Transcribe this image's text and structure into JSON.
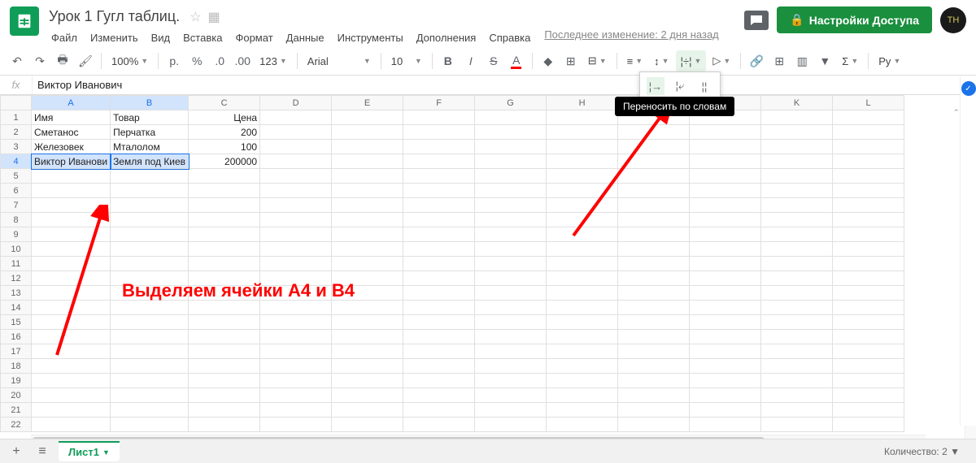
{
  "doc_title": "Урок 1 Гугл таблиц.",
  "menubar": [
    "Файл",
    "Изменить",
    "Вид",
    "Вставка",
    "Формат",
    "Данные",
    "Инструменты",
    "Дополнения",
    "Справка"
  ],
  "last_edit": "Последнее изменение: 2 дня назад",
  "share_label": "Настройки Доступа",
  "toolbar": {
    "zoom": "100%",
    "currency": "р.",
    "percent": "%",
    "dec_less": ".0",
    "dec_more": ".00",
    "num_format": "123",
    "font": "Arial",
    "font_size": "10",
    "input_help": "Ру"
  },
  "tooltip": "Переносить по словам",
  "fx_label": "fx",
  "fx_value": "Виктор Иванович",
  "columns": [
    "A",
    "B",
    "C",
    "D",
    "E",
    "F",
    "G",
    "H",
    "I",
    "J",
    "K",
    "L"
  ],
  "rows_count": 22,
  "data": {
    "r1": {
      "A": "Имя",
      "B": "Товар",
      "C": "Цена"
    },
    "r2": {
      "A": "Сметанос",
      "B": "Перчатка",
      "C": "200"
    },
    "r3": {
      "A": "Железовек",
      "B": "Мталолом",
      "C": "100"
    },
    "r4": {
      "A": "Виктор Иванови",
      "B": "Земля под Киев",
      "C": "200000"
    }
  },
  "sheet_tab": "Лист1",
  "status": "Количество: 2",
  "annotation": "Выделяем ячейки А4 и В4"
}
